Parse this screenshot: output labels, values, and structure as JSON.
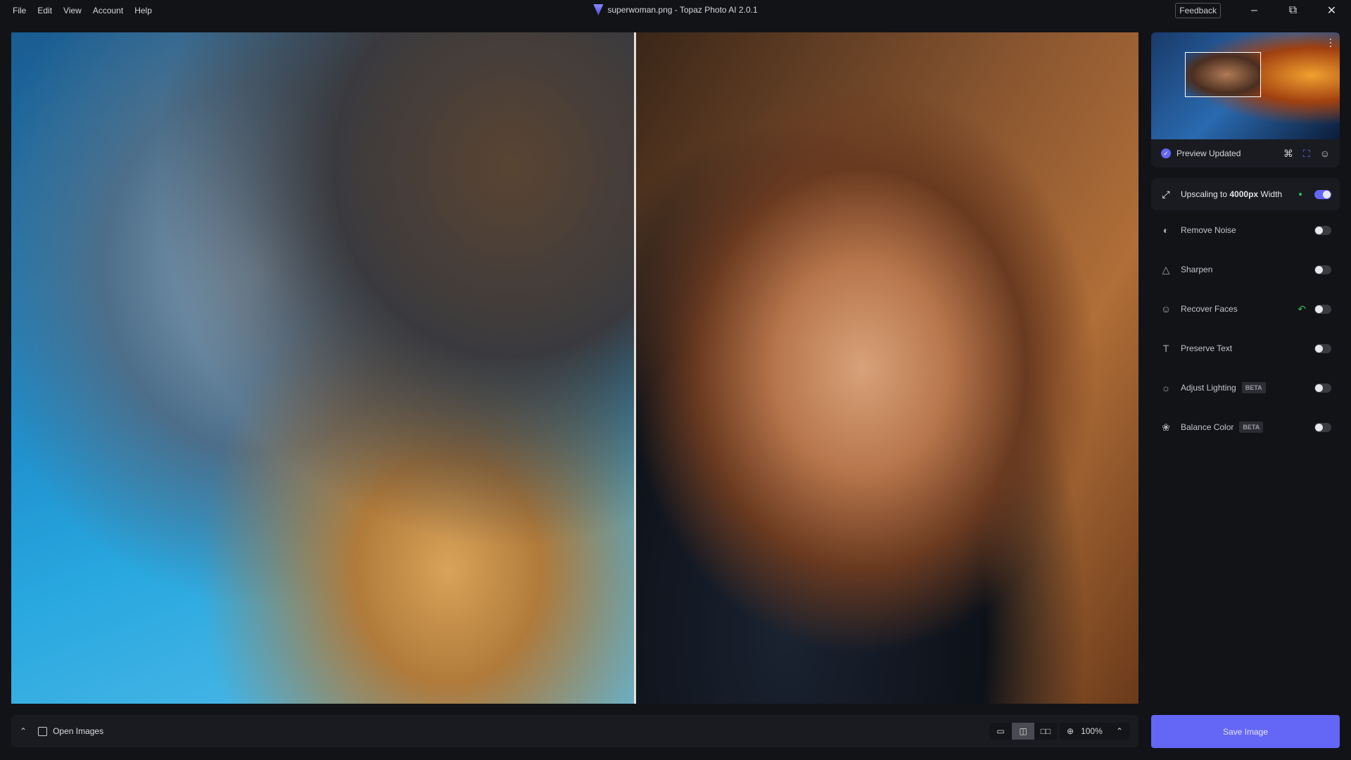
{
  "menu": [
    "File",
    "Edit",
    "View",
    "Account",
    "Help"
  ],
  "window": {
    "title": "superwoman.png - Topaz Photo AI 2.0.1",
    "feedback": "Feedback"
  },
  "preview": {
    "status": "Preview Updated"
  },
  "upscale": {
    "prefix": "Upscaling to ",
    "value": "4000px",
    "suffix": " Width",
    "enabled": true
  },
  "filters": [
    {
      "label": "Remove Noise",
      "icon": "noise-icon",
      "enabled": false
    },
    {
      "label": "Sharpen",
      "icon": "triangle-icon",
      "enabled": false
    },
    {
      "label": "Recover Faces",
      "icon": "face-icon",
      "enabled": false,
      "reset": true
    },
    {
      "label": "Preserve Text",
      "icon": "text-icon",
      "enabled": false
    },
    {
      "label": "Adjust Lighting",
      "icon": "sun-icon",
      "enabled": false,
      "badge": "BETA"
    },
    {
      "label": "Balance Color",
      "icon": "color-circles-icon",
      "enabled": false,
      "badge": "BETA"
    }
  ],
  "bottom": {
    "open_images": "Open Images",
    "zoom": "100%",
    "view_mode": "split"
  },
  "save_label": "Save Image",
  "colors": {
    "accent": "#6466f5",
    "ok": "#2fbf5a",
    "bg": "#121317"
  }
}
